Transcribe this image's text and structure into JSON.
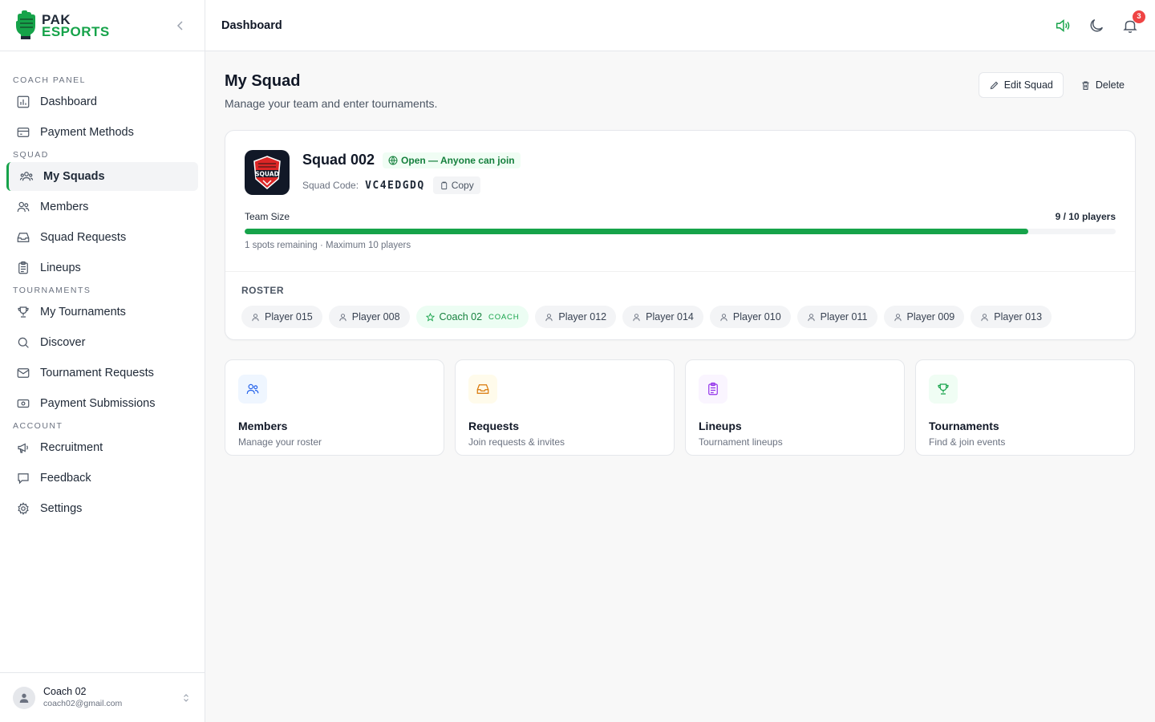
{
  "brand": {
    "line1": "PAK",
    "line2": "ESPORTS"
  },
  "sidebar": {
    "sections": [
      {
        "title": "COACH PANEL",
        "items": [
          {
            "label": "Dashboard",
            "icon": "bar-chart-icon"
          },
          {
            "label": "Payment Methods",
            "icon": "credit-card-icon"
          }
        ]
      },
      {
        "title": "SQUAD",
        "items": [
          {
            "label": "My Squads",
            "icon": "users-icon",
            "active": true
          },
          {
            "label": "Members",
            "icon": "user-group-icon"
          },
          {
            "label": "Squad Requests",
            "icon": "inbox-icon"
          },
          {
            "label": "Lineups",
            "icon": "clipboard-icon"
          }
        ]
      },
      {
        "title": "TOURNAMENTS",
        "items": [
          {
            "label": "My Tournaments",
            "icon": "trophy-icon"
          },
          {
            "label": "Discover",
            "icon": "search-icon"
          },
          {
            "label": "Tournament Requests",
            "icon": "mail-icon"
          },
          {
            "label": "Payment Submissions",
            "icon": "banknote-icon"
          }
        ]
      },
      {
        "title": "ACCOUNT",
        "items": [
          {
            "label": "Recruitment",
            "icon": "megaphone-icon"
          },
          {
            "label": "Feedback",
            "icon": "message-icon"
          },
          {
            "label": "Settings",
            "icon": "gear-icon"
          }
        ]
      }
    ]
  },
  "user": {
    "name": "Coach 02",
    "email": "coach02@gmail.com"
  },
  "topbar": {
    "title": "Dashboard",
    "notification_count": "3"
  },
  "page": {
    "title": "My Squad",
    "subtitle": "Manage your team and enter tournaments.",
    "edit_label": "Edit Squad",
    "delete_label": "Delete"
  },
  "squad": {
    "name": "Squad 002",
    "logo_text": "SQUAD",
    "status_badge": "Open — Anyone can join",
    "code_label": "Squad Code:",
    "code": "VC4EDGDQ",
    "copy_label": "Copy",
    "team_size_label": "Team Size",
    "team_size_count": "9 / 10 players",
    "team_size_fraction": 0.9,
    "team_size_note": "1 spots remaining · Maximum 10 players",
    "roster_title": "ROSTER",
    "roster": [
      {
        "name": "Player 015"
      },
      {
        "name": "Player 008"
      },
      {
        "name": "Coach 02",
        "tag": "COACH"
      },
      {
        "name": "Player 012"
      },
      {
        "name": "Player 014"
      },
      {
        "name": "Player 010"
      },
      {
        "name": "Player 011"
      },
      {
        "name": "Player 009"
      },
      {
        "name": "Player 013"
      }
    ]
  },
  "quick_links": [
    {
      "title": "Members",
      "subtitle": "Manage your roster",
      "icon": "users-icon",
      "color": "#2563eb",
      "bg": "#eff6ff"
    },
    {
      "title": "Requests",
      "subtitle": "Join requests & invites",
      "icon": "inbox-icon",
      "color": "#d97706",
      "bg": "#fffbeb"
    },
    {
      "title": "Lineups",
      "subtitle": "Tournament lineups",
      "icon": "clipboard-icon",
      "color": "#9333ea",
      "bg": "#faf5ff"
    },
    {
      "title": "Tournaments",
      "subtitle": "Find & join events",
      "icon": "trophy-icon",
      "color": "#16a34a",
      "bg": "#f0fdf4"
    }
  ],
  "colors": {
    "accent": "#16a34a",
    "badge": "#ef4444"
  }
}
